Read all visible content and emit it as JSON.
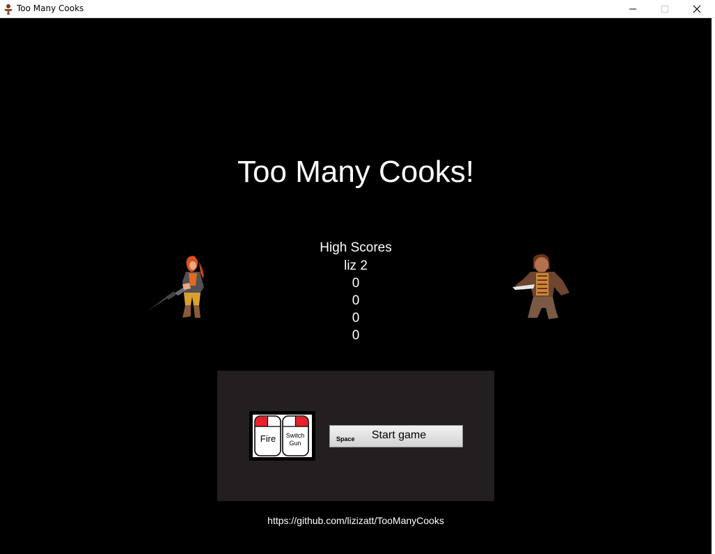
{
  "window": {
    "title": "Too Many Cooks",
    "icon": "cook-app-icon",
    "controls": [
      "minimize-icon",
      "maximize-icon",
      "close-icon"
    ]
  },
  "game": {
    "title": "Too Many Cooks!",
    "high_scores": {
      "heading": "High Scores",
      "entries": [
        "liz 2",
        "0",
        "0",
        "0",
        "0"
      ]
    },
    "controls": {
      "left_click": "Fire",
      "right_click": "Switch Gun",
      "key_hint": "Space",
      "start_label": "Start game"
    },
    "link": "https://github.com/lizizatt/TooManyCooks"
  },
  "colors": {
    "background": "#000000",
    "panel": "#231f20",
    "text": "#ffffff",
    "mouse_button_red": "#e8202a"
  }
}
